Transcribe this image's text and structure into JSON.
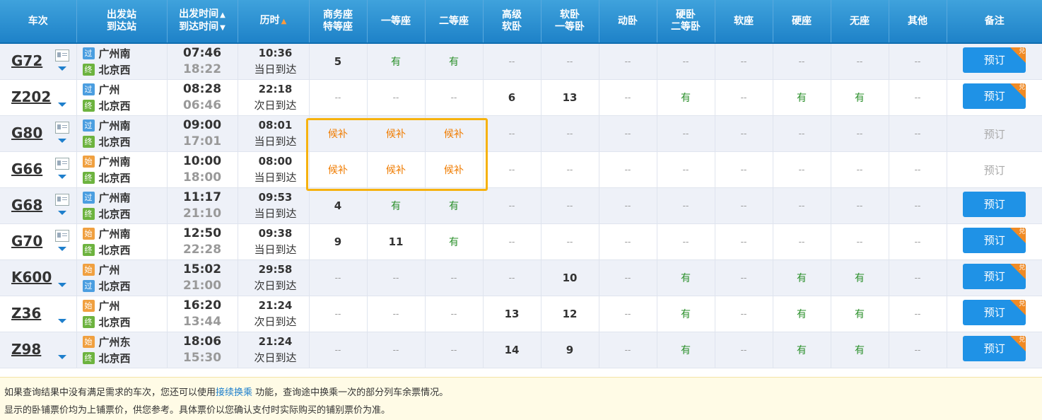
{
  "headers": {
    "train": "车次",
    "station_top": "出发站",
    "station_bottom": "到达站",
    "time_top": "出发时间",
    "time_bottom": "到达时间",
    "duration": "历时",
    "swz_top": "商务座",
    "swz_bottom": "特等座",
    "ydz": "一等座",
    "edz": "二等座",
    "gjrw_top": "高级",
    "gjrw_bottom": "软卧",
    "rw_top": "软卧",
    "rw_bottom": "一等卧",
    "dw": "动卧",
    "yw_top": "硬卧",
    "yw_bottom": "二等卧",
    "rz": "软座",
    "yz": "硬座",
    "wz": "无座",
    "qt": "其他",
    "remark": "备注"
  },
  "labels": {
    "book": "预订",
    "dui": "兑",
    "badge_guo": "过",
    "badge_zhong": "终",
    "badge_shi": "始"
  },
  "rows": [
    {
      "no": "G72",
      "from": "广州南",
      "to": "北京西",
      "from_badge": "过",
      "to_badge": "终",
      "dep": "07:46",
      "arr": "18:22",
      "dur": "10:36",
      "day": "当日到达",
      "seats": [
        "5",
        "有",
        "有",
        "--",
        "--",
        "--",
        "--",
        "--",
        "--",
        "--",
        "--"
      ],
      "book": "预订",
      "bookable": true,
      "dui": true,
      "icon": true
    },
    {
      "no": "Z202",
      "from": "广州",
      "to": "北京西",
      "from_badge": "过",
      "to_badge": "终",
      "dep": "08:28",
      "arr": "06:46",
      "dur": "22:18",
      "day": "次日到达",
      "seats": [
        "--",
        "--",
        "--",
        "6",
        "13",
        "--",
        "有",
        "--",
        "有",
        "有",
        "--"
      ],
      "book": "预订",
      "bookable": true,
      "dui": true,
      "icon": false
    },
    {
      "no": "G80",
      "from": "广州南",
      "to": "北京西",
      "from_badge": "过",
      "to_badge": "终",
      "dep": "09:00",
      "arr": "17:01",
      "dur": "08:01",
      "day": "当日到达",
      "seats": [
        "候补",
        "候补",
        "候补",
        "--",
        "--",
        "--",
        "--",
        "--",
        "--",
        "--",
        "--"
      ],
      "book": "预订",
      "bookable": false,
      "dui": false,
      "icon": true
    },
    {
      "no": "G66",
      "from": "广州南",
      "to": "北京西",
      "from_badge": "始",
      "to_badge": "终",
      "dep": "10:00",
      "arr": "18:00",
      "dur": "08:00",
      "day": "当日到达",
      "seats": [
        "候补",
        "候补",
        "候补",
        "--",
        "--",
        "--",
        "--",
        "--",
        "--",
        "--",
        "--"
      ],
      "book": "预订",
      "bookable": false,
      "dui": false,
      "icon": true
    },
    {
      "no": "G68",
      "from": "广州南",
      "to": "北京西",
      "from_badge": "过",
      "to_badge": "终",
      "dep": "11:17",
      "arr": "21:10",
      "dur": "09:53",
      "day": "当日到达",
      "seats": [
        "4",
        "有",
        "有",
        "--",
        "--",
        "--",
        "--",
        "--",
        "--",
        "--",
        "--"
      ],
      "book": "预订",
      "bookable": true,
      "dui": false,
      "icon": true
    },
    {
      "no": "G70",
      "from": "广州南",
      "to": "北京西",
      "from_badge": "始",
      "to_badge": "终",
      "dep": "12:50",
      "arr": "22:28",
      "dur": "09:38",
      "day": "当日到达",
      "seats": [
        "9",
        "11",
        "有",
        "--",
        "--",
        "--",
        "--",
        "--",
        "--",
        "--",
        "--"
      ],
      "book": "预订",
      "bookable": true,
      "dui": true,
      "icon": true
    },
    {
      "no": "K600",
      "from": "广州",
      "to": "北京西",
      "from_badge": "始",
      "to_badge": "过",
      "dep": "15:02",
      "arr": "21:00",
      "dur": "29:58",
      "day": "次日到达",
      "seats": [
        "--",
        "--",
        "--",
        "--",
        "10",
        "--",
        "有",
        "--",
        "有",
        "有",
        "--"
      ],
      "book": "预订",
      "bookable": true,
      "dui": true,
      "icon": false
    },
    {
      "no": "Z36",
      "from": "广州",
      "to": "北京西",
      "from_badge": "始",
      "to_badge": "终",
      "dep": "16:20",
      "arr": "13:44",
      "dur": "21:24",
      "day": "次日到达",
      "seats": [
        "--",
        "--",
        "--",
        "13",
        "12",
        "--",
        "有",
        "--",
        "有",
        "有",
        "--"
      ],
      "book": "预订",
      "bookable": true,
      "dui": true,
      "icon": false
    },
    {
      "no": "Z98",
      "from": "广州东",
      "to": "北京西",
      "from_badge": "始",
      "to_badge": "终",
      "dep": "18:06",
      "arr": "15:30",
      "dur": "21:24",
      "day": "次日到达",
      "seats": [
        "--",
        "--",
        "--",
        "14",
        "9",
        "--",
        "有",
        "--",
        "有",
        "有",
        "--"
      ],
      "book": "预订",
      "bookable": true,
      "dui": true,
      "icon": false
    }
  ],
  "notes": {
    "line1_pre": "如果查询结果中没有满足需求的车次，您还可以使用",
    "line1_link": "接续换乘",
    "line1_post": " 功能，查询途中换乘一次的部分列车余票情况。",
    "line2": "显示的卧铺票价均为上铺票价，供您参考。具体票价以您确认支付时实际购买的铺别票价为准。"
  },
  "colors": {
    "header_bg": "#1e82c8",
    "book_button": "#1f92e6",
    "available_text": "#2a8f2a",
    "waitlist_text": "#f07c00",
    "highlight_border": "#f6b20f"
  }
}
